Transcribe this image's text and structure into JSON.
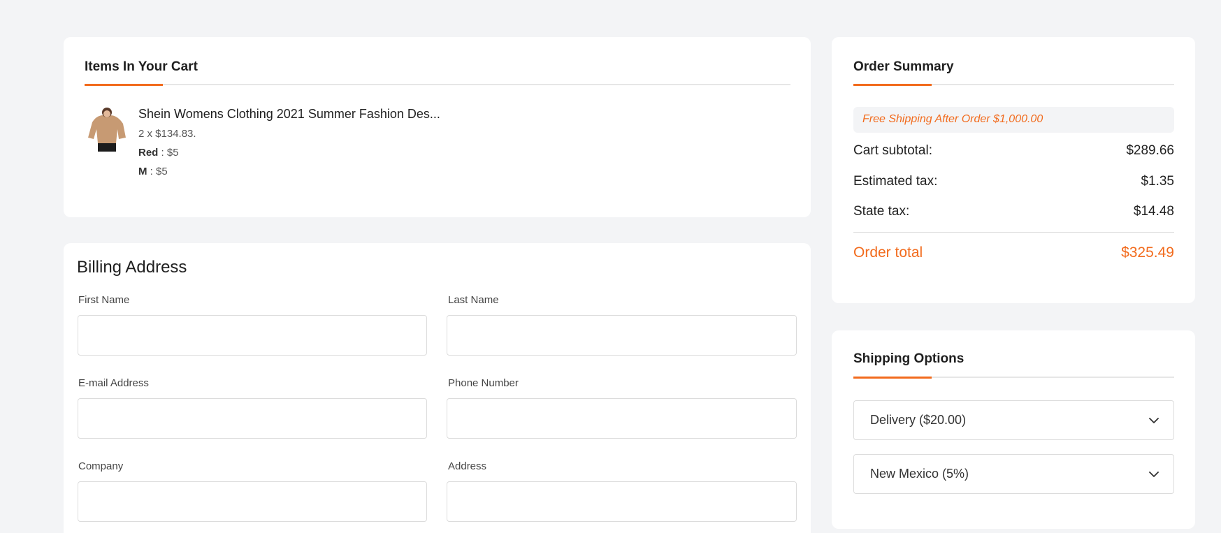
{
  "cart": {
    "title": "Items In Your Cart",
    "item": {
      "name": "Shein Womens Clothing 2021 Summer Fashion Des...",
      "qty_price": "2 x $134.83.",
      "attributes": [
        {
          "name": "Red",
          "value": " : $5"
        },
        {
          "name": "M",
          "value": " : $5"
        }
      ]
    }
  },
  "billing": {
    "title": "Billing Address",
    "fields": {
      "first_name": {
        "label": "First Name",
        "value": ""
      },
      "last_name": {
        "label": "Last Name",
        "value": ""
      },
      "email": {
        "label": "E-mail Address",
        "value": ""
      },
      "phone": {
        "label": "Phone Number",
        "value": ""
      },
      "company": {
        "label": "Company",
        "value": ""
      },
      "address": {
        "label": "Address",
        "value": ""
      }
    }
  },
  "summary": {
    "title": "Order Summary",
    "free_shipping": "Free Shipping After Order $1,000.00",
    "rows": [
      {
        "label": "Cart subtotal:",
        "value": "$289.66"
      },
      {
        "label": "Estimated tax:",
        "value": "$1.35"
      },
      {
        "label": "State tax:",
        "value": "$14.48"
      }
    ],
    "total_label": "Order total",
    "total_value": "$325.49"
  },
  "shipping": {
    "title": "Shipping Options",
    "delivery_selected": "Delivery ($20.00)",
    "state_selected": "New Mexico (5%)"
  },
  "colors": {
    "accent": "#f26b1d",
    "background": "#f3f4f6",
    "card": "#ffffff"
  }
}
